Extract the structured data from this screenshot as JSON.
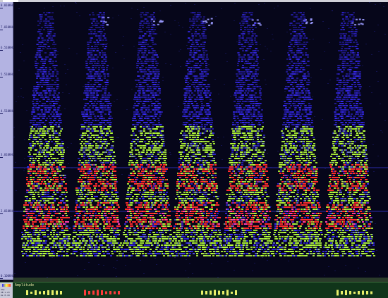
{
  "freq_ruler": {
    "ticks": [
      "8.010KHz",
      "7.010KHz",
      "6.510KHz",
      "5.510KHz",
      "4.510KHz",
      "3.010KHz",
      "2.010KHz",
      "0.100KHz"
    ]
  },
  "time_axis": {
    "labels": [
      "",
      "",
      "",
      ""
    ]
  },
  "bottom_panel": {
    "amp_label": "Amplitude",
    "left_labels": [
      "amp",
      "dB 1.23",
      "ms 0.44"
    ]
  },
  "colors": {
    "low": "#3a2cff",
    "mid": "#b6ff3a",
    "high": "#ff2b2b",
    "peak": "#ff3fb0",
    "wave": "#e9f06a",
    "wave_selected": "#ff3b3b"
  },
  "spectrogram": {
    "burst_count": 7
  }
}
